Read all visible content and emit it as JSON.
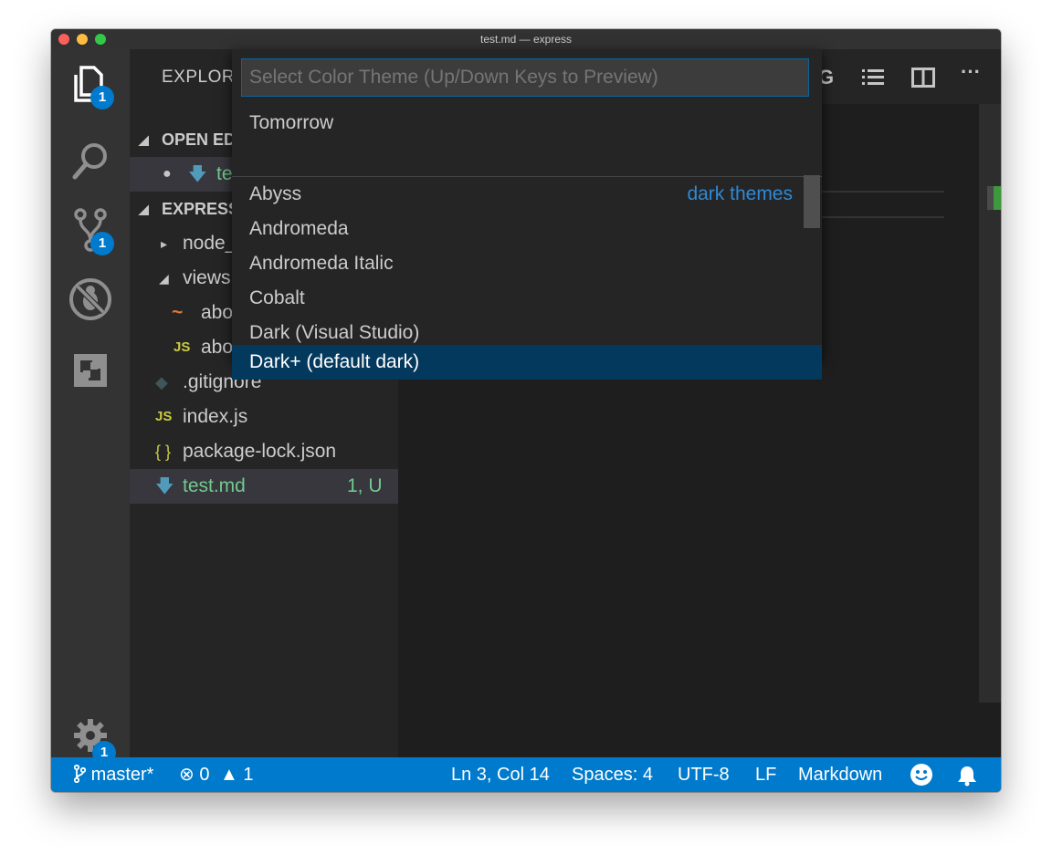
{
  "window": {
    "title": "test.md — express"
  },
  "activity_bar": {
    "explorer_badge": "1",
    "scm_badge": "1",
    "settings_badge": "1"
  },
  "sidebar": {
    "title": "EXPLORE",
    "open_editors_label": "OPEN ED",
    "open_editor_item": "te",
    "project_label": "EXPRESS",
    "items": [
      {
        "label": "node_",
        "icon": "chevron-right-icon"
      },
      {
        "label": "views",
        "icon": "chevron-down-icon"
      },
      {
        "label": "abo",
        "icon": "html-file-icon"
      },
      {
        "label": "abo",
        "icon": "js-file-icon"
      },
      {
        "label": ".gitignore",
        "icon": "git-file-icon"
      },
      {
        "label": "index.js",
        "icon": "js-file-icon"
      },
      {
        "label": "package-lock.json",
        "icon": "json-file-icon"
      },
      {
        "label": "test.md",
        "icon": "markdown-file-icon",
        "status": "1, U"
      }
    ],
    "icon_text": {
      "js": "JS",
      "json": "{ }",
      "html": "~"
    }
  },
  "quick_pick": {
    "placeholder": "Select Color Theme (Up/Down Keys to Preview)",
    "recent": "Tomorrow",
    "group_label": "dark themes",
    "items": [
      "Abyss",
      "Andromeda",
      "Andromeda Italic",
      "Cobalt",
      "Dark (Visual Studio)",
      "Dark+ (default dark)"
    ],
    "selected_index": 5
  },
  "status_bar": {
    "branch": "master*",
    "errors": "0",
    "warnings": "1",
    "position": "Ln 3, Col 14",
    "spaces": "Spaces: 4",
    "encoding": "UTF-8",
    "eol": "LF",
    "language": "Markdown"
  },
  "colors": {
    "accent": "#007acc",
    "modified_green": "#73c991",
    "selection": "#04395e"
  }
}
